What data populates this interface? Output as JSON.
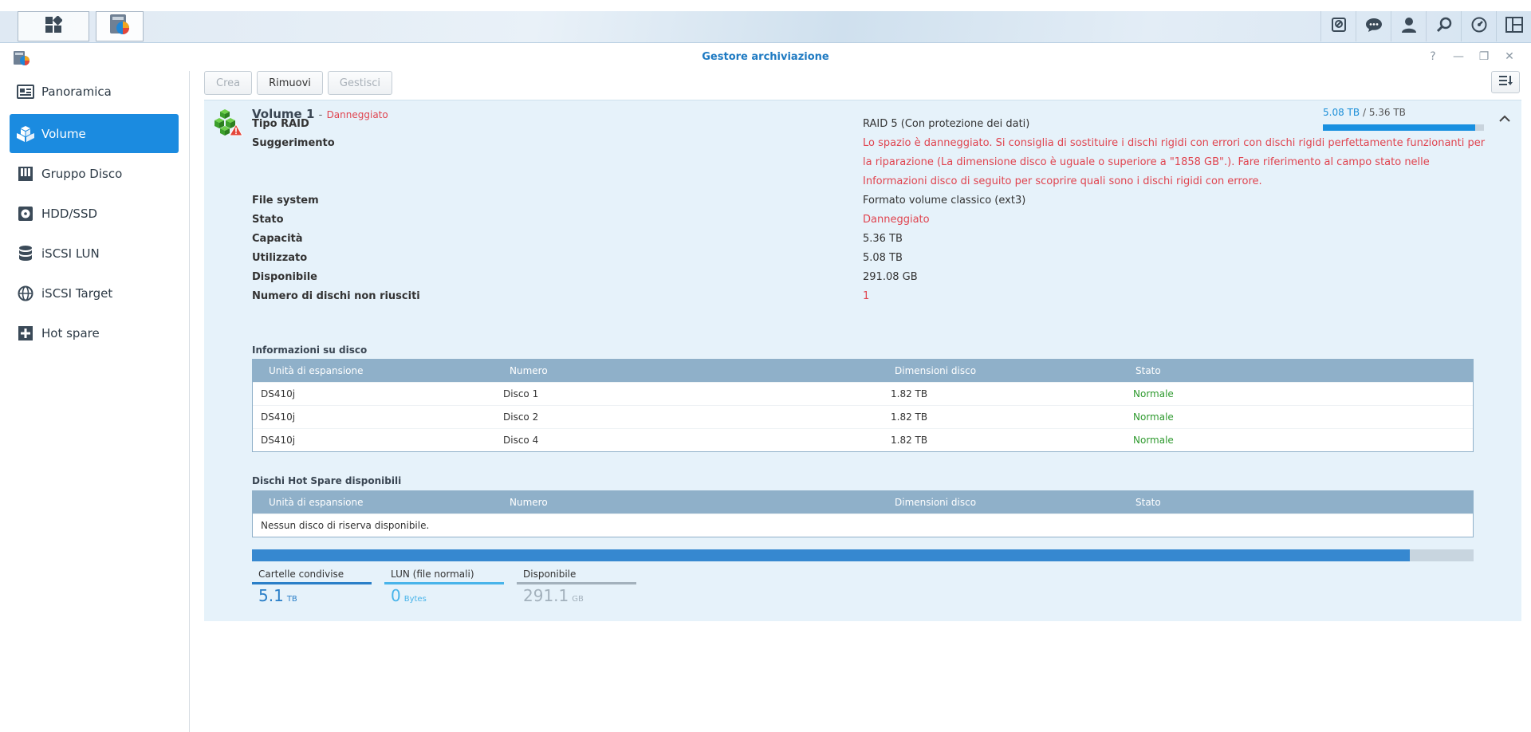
{
  "window": {
    "title": "Gestore archiviazione"
  },
  "taskbar": {
    "icons": [
      "main-menu-icon",
      "storage-manager-app-icon",
      "media-card-icon",
      "chat-icon",
      "user-icon",
      "search-icon",
      "widgets-dashboard-icon",
      "layout-icon"
    ]
  },
  "sidebar": {
    "items": [
      {
        "label": "Panoramica",
        "icon": "overview-icon"
      },
      {
        "label": "Volume",
        "icon": "volume-icon"
      },
      {
        "label": "Gruppo Disco",
        "icon": "disk-group-icon"
      },
      {
        "label": "HDD/SSD",
        "icon": "hdd-icon"
      },
      {
        "label": "iSCSI LUN",
        "icon": "iscsi-lun-icon"
      },
      {
        "label": "iSCSI Target",
        "icon": "iscsi-target-icon"
      },
      {
        "label": "Hot spare",
        "icon": "hot-spare-icon"
      }
    ],
    "active": "Volume"
  },
  "toolbar": {
    "create_label": "Crea",
    "remove_label": "Rimuovi",
    "manage_label": "Gestisci"
  },
  "volume": {
    "name": "Volume 1",
    "separator": "-",
    "status_label": "Danneggiato",
    "usage_used": "5.08 TB",
    "usage_sep": "/",
    "usage_total": "5.36 TB",
    "usage_fraction": 0.948,
    "details": [
      {
        "label": "Tipo RAID",
        "value": "RAID 5 (Con protezione dei dati)"
      },
      {
        "label": "Suggerimento",
        "value": "Lo spazio è danneggiato. Si consiglia di sostituire i dischi rigidi con errori con dischi rigidi perfettamente funzionanti per la riparazione (La dimensione disco è uguale o superiore a \"1858 GB\".). Fare riferimento al campo stato nelle Informazioni disco di seguito per scoprire quali sono i dischi rigidi con errore."
      },
      {
        "label": "File system",
        "value": "Formato volume classico (ext3)"
      },
      {
        "label": "Stato",
        "value": "Danneggiato"
      },
      {
        "label": "Capacità",
        "value": "5.36 TB"
      },
      {
        "label": "Utilizzato",
        "value": "5.08 TB"
      },
      {
        "label": "Disponibile",
        "value": "291.08 GB"
      },
      {
        "label": "Numero di dischi non riusciti",
        "value": "1"
      }
    ]
  },
  "disk_info": {
    "title": "Informazioni su disco",
    "columns": [
      "Unità di espansione",
      "Numero",
      "Dimensioni disco",
      "Stato"
    ],
    "rows": [
      [
        "DS410j",
        "Disco 1",
        "1.82 TB",
        "Normale"
      ],
      [
        "DS410j",
        "Disco 2",
        "1.82 TB",
        "Normale"
      ],
      [
        "DS410j",
        "Disco 4",
        "1.82 TB",
        "Normale"
      ]
    ]
  },
  "hot_spare": {
    "title": "Dischi Hot Spare disponibili",
    "columns": [
      "Unità di espansione",
      "Numero",
      "Dimensioni disco",
      "Stato"
    ],
    "empty_text": "Nessun disco di riserva disponibile."
  },
  "capacity": {
    "used_fraction": 0.948,
    "legend": [
      {
        "label": "Cartelle condivise",
        "value": "5.1",
        "unit": "TB",
        "color": "#2a7fc8"
      },
      {
        "label": "LUN (file normali)",
        "value": "0",
        "unit": "Bytes",
        "color": "#48b4ea"
      },
      {
        "label": "Disponibile",
        "value": "291.1",
        "unit": "GB",
        "color": "#a3b1bc"
      }
    ]
  },
  "colors": {
    "accent": "#1b8be0",
    "error": "#e0444f",
    "ok": "#2f9a2f",
    "title": "#1e7ac2"
  }
}
